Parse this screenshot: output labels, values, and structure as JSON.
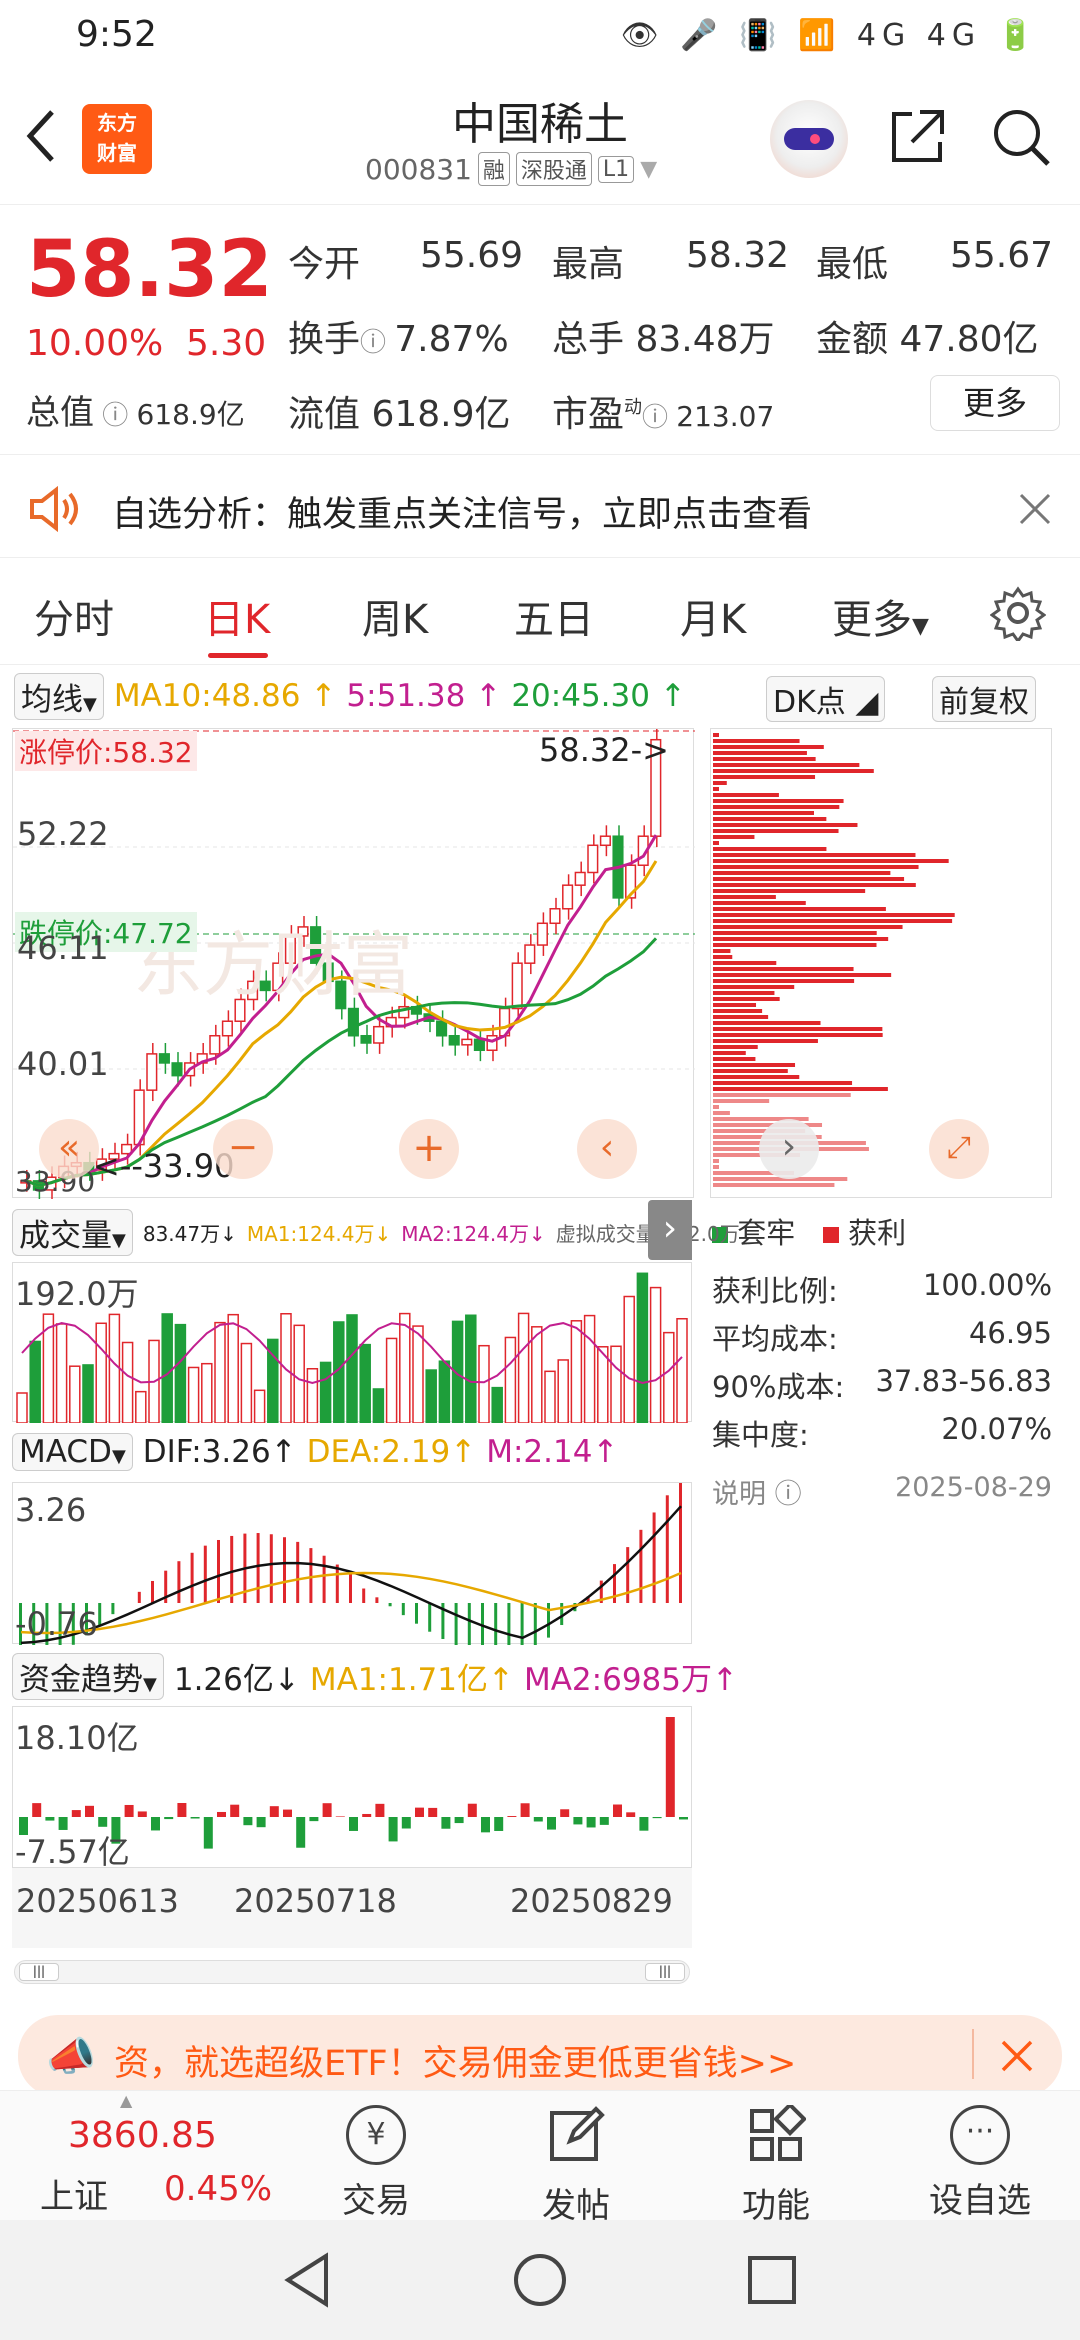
{
  "status_bar": {
    "time": "9:52",
    "icons": "👁 🎤 📳 📶 4G 4G 🔋"
  },
  "header": {
    "logo_line1": "东方",
    "logo_line2": "财富",
    "title": "中国稀土",
    "code": "000831",
    "tags": [
      "融",
      "深股通",
      "L1"
    ]
  },
  "quote": {
    "price": "58.32",
    "pct": "10.00%",
    "change": "5.30",
    "open_label": "今开",
    "open": "55.69",
    "high_label": "最高",
    "high": "58.32",
    "low_label": "最低",
    "low": "55.67",
    "turnover_label": "换手",
    "turnover": "7.87%",
    "volume_label": "总手",
    "volume": "83.48万",
    "amount_label": "金额",
    "amount": "47.80亿",
    "mktcap_label": "总值",
    "mktcap": "618.9亿",
    "float_label": "流值",
    "float": "618.9亿",
    "pe_label": "市盈",
    "pe_sup": "动",
    "pe": "213.07",
    "more": "更多"
  },
  "notice": {
    "text": "自选分析：触发重点关注信号，立即点击查看"
  },
  "tabs": [
    "分时",
    "日K",
    "周K",
    "五日",
    "月K",
    "更多"
  ],
  "ma_bar": {
    "select": "均线",
    "ma10": "MA10:48.86",
    "ma5": "5:51.38",
    "ma20": "20:45.30",
    "dk": "DK点",
    "fq": "前复权"
  },
  "kchart": {
    "limit_up": "涨停价:58.32",
    "limit_down": "跌停价:47.72",
    "last": "58.32",
    "y_top": "52.22",
    "y_mid": "46.11",
    "y_low": "40.01",
    "min_mark": "33.90",
    "min_label": "33.90"
  },
  "volume_bar": {
    "select": "成交量",
    "v": "83.47万↓",
    "ma1": "MA1:124.4万↓",
    "ma2": "MA2:124.4万↓",
    "virtual": "虚拟成交量:192.0万",
    "ymax": "192.0万"
  },
  "macd_bar": {
    "select": "MACD",
    "dif": "DIF:3.26↑",
    "dea": "DEA:2.19↑",
    "m": "M:2.14↑",
    "ymax": "3.26",
    "ymin": "-0.76"
  },
  "fund_bar": {
    "select": "资金趋势",
    "v": "1.26亿↓",
    "ma1": "MA1:1.71亿↑",
    "ma2": "MA2:6985万↑",
    "ymax": "18.10亿",
    "ymin": "-7.57亿"
  },
  "dates": [
    "20250613",
    "20250718",
    "20250829"
  ],
  "chips": {
    "legend_trap": "套牢",
    "legend_profit": "获利",
    "rows": [
      [
        "获利比例:",
        "100.00%"
      ],
      [
        "平均成本:",
        "46.95"
      ],
      [
        "90%成本:",
        "37.83-56.83"
      ],
      [
        "集中度:",
        "20.07%"
      ]
    ],
    "note": "说明",
    "date": "2025-08-29"
  },
  "ad": {
    "text": "资，就选超级ETF！交易佣金更低更省钱>>"
  },
  "bottom_nav": {
    "index_name": "上证",
    "index_value": "3860.85",
    "index_pct": "0.45%",
    "items": [
      "交易",
      "发帖",
      "功能",
      "设自选"
    ]
  },
  "colors": {
    "up": "#e0262b",
    "down": "#1e9e3a",
    "brand": "#ff5a14"
  }
}
